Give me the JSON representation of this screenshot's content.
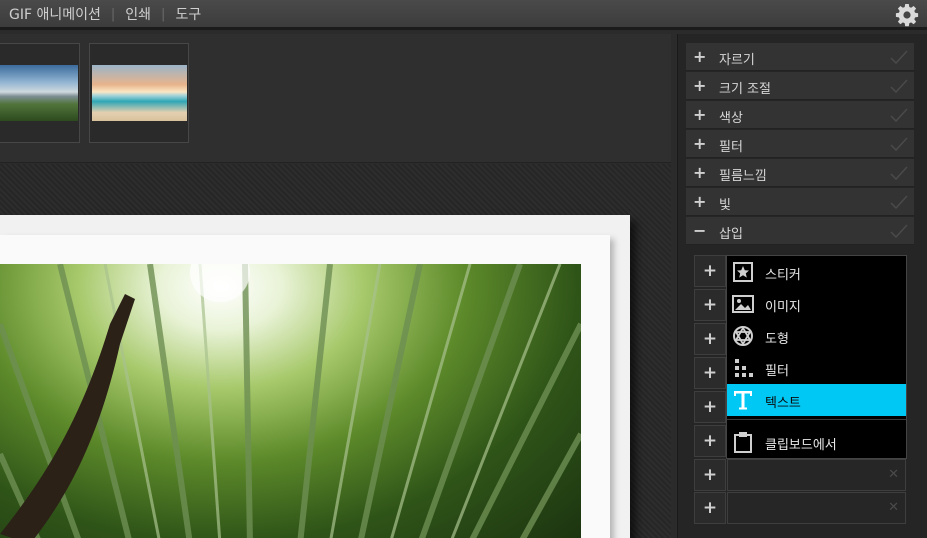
{
  "topbar": {
    "menu": [
      "GIF 애니메이션",
      "인쇄",
      "도구"
    ],
    "settings_icon": "gear-icon"
  },
  "thumbnails": [
    {
      "name": "mountain-landscape"
    },
    {
      "name": "beach-sunset"
    }
  ],
  "panel": {
    "accordion": [
      {
        "label": "자르기",
        "state": "+"
      },
      {
        "label": "크기 조절",
        "state": "+"
      },
      {
        "label": "색상",
        "state": "+"
      },
      {
        "label": "필터",
        "state": "+"
      },
      {
        "label": "필름느낌",
        "state": "+"
      },
      {
        "label": "빛",
        "state": "+"
      },
      {
        "label": "삽입",
        "state": "−"
      }
    ],
    "insert_slot_plus": "+",
    "insert_slot_remove": "✕"
  },
  "dropdown": {
    "items": [
      {
        "label": "스티커",
        "icon": "sticker-icon"
      },
      {
        "label": "이미지",
        "icon": "image-icon"
      },
      {
        "label": "도형",
        "icon": "shape-icon"
      },
      {
        "label": "필터",
        "icon": "filter-icon"
      },
      {
        "label": "텍스트",
        "icon": "text-icon",
        "active": true
      },
      {
        "label": "클립보드에서",
        "icon": "clipboard-icon"
      }
    ],
    "active_color": "#00c8f4"
  }
}
